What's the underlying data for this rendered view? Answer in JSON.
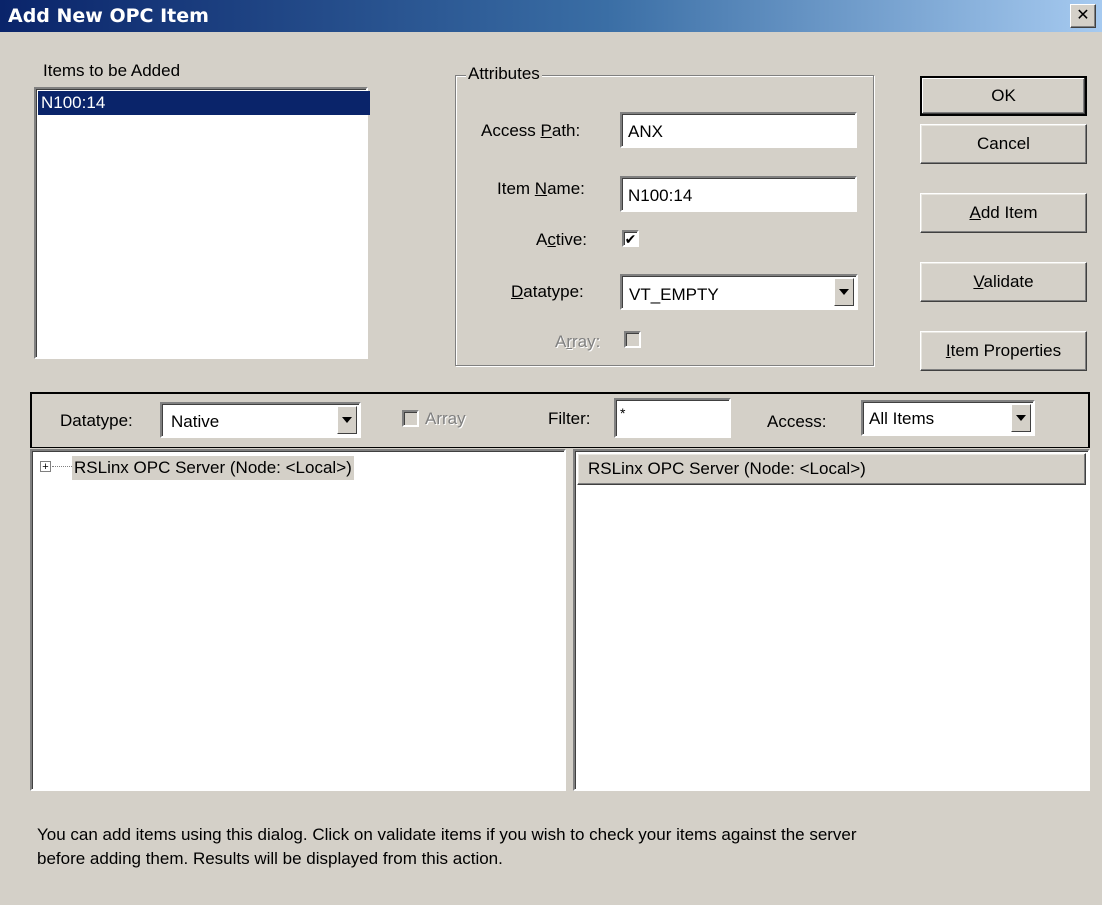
{
  "window": {
    "title": "Add New OPC Item",
    "close_glyph": "✕"
  },
  "items_to_add": {
    "label": "Items to be Added",
    "items": [
      "N100:14"
    ]
  },
  "attributes": {
    "group_label": "Attributes",
    "access_path_label_pre": "Access ",
    "access_path_label_key": "P",
    "access_path_label_post": "ath:",
    "access_path_value": "ANX",
    "item_name_label_pre": "Item ",
    "item_name_label_key": "N",
    "item_name_label_post": "ame:",
    "item_name_value": "N100:14",
    "active_label_pre": "A",
    "active_label_key": "c",
    "active_label_post": "tive:",
    "active_checked": "✔",
    "datatype_label_key": "D",
    "datatype_label_post": "atatype:",
    "datatype_value": "VT_EMPTY",
    "array_label_pre": "A",
    "array_label_key": "r",
    "array_label_post": "ray:"
  },
  "buttons": {
    "ok": "OK",
    "cancel": "Cancel",
    "add_item_key": "A",
    "add_item_post": "dd Item",
    "validate_key": "V",
    "validate_post": "alidate",
    "item_properties_key": "I",
    "item_properties_post": "tem Properties"
  },
  "filter_bar": {
    "datatype_label": "Datatype:",
    "datatype_value": "Native",
    "array_label": "Array",
    "filter_label": "Filter:",
    "filter_value": "*",
    "access_label": "Access:",
    "access_value": "All Items"
  },
  "tree": {
    "expander": "+",
    "root_label": "RSLinx OPC Server (Node: <Local>)"
  },
  "list_panel": {
    "header": "RSLinx OPC Server (Node: <Local>)"
  },
  "help_text": {
    "line1": "You can add items using this dialog.  Click on validate items if you wish to check your items against the server",
    "line2": "before adding them.  Results will be displayed from this action."
  }
}
